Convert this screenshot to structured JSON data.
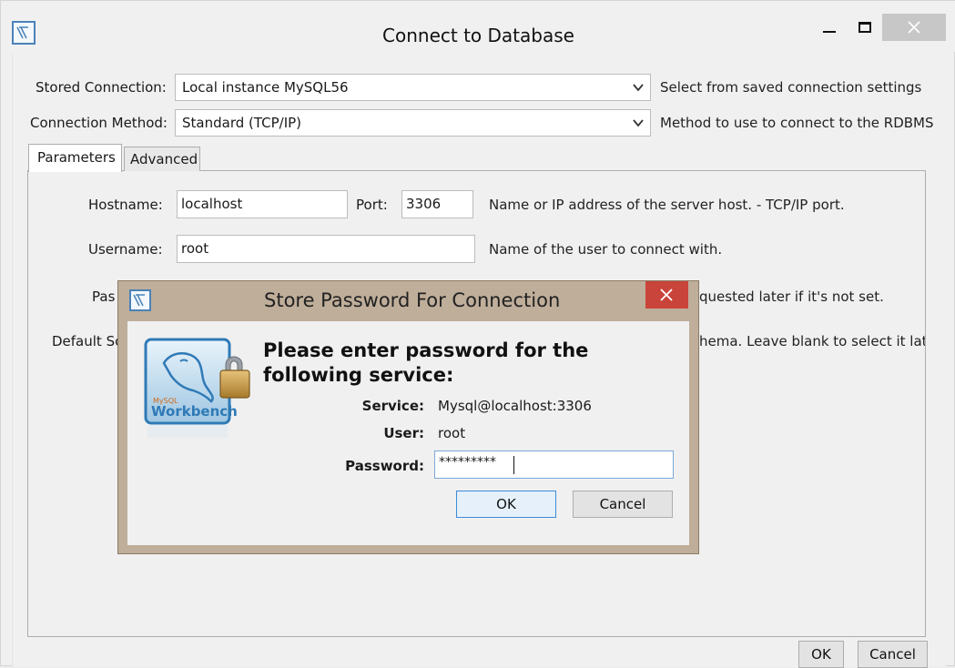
{
  "window": {
    "title": "Connect to Database",
    "buttons": {
      "ok": "OK",
      "cancel": "Cancel"
    }
  },
  "stored_connection": {
    "label": "Stored Connection:",
    "value": "Local instance MySQL56",
    "help": "Select from saved connection settings"
  },
  "connection_method": {
    "label": "Connection Method:",
    "value": "Standard (TCP/IP)",
    "help": "Method to use to connect to the RDBMS"
  },
  "tabs": [
    {
      "label": "Parameters",
      "active": true
    },
    {
      "label": "Advanced",
      "active": false
    }
  ],
  "parameters": {
    "hostname": {
      "label": "Hostname:",
      "value": "localhost"
    },
    "port": {
      "label": "Port:",
      "value": "3306"
    },
    "hostname_help": "Name or IP address of the server host. - TCP/IP port.",
    "username": {
      "label": "Username:",
      "value": "root",
      "help": "Name of the user to connect with."
    },
    "password_label_partial": "Pas",
    "password_help_partial": "quested later if it's not set.",
    "default_schema_label_partial": "Default Sc",
    "default_schema_help_partial": "hema. Leave blank to select it late"
  },
  "dialog": {
    "title": "Store Password For Connection",
    "heading_line1": "Please enter password for the",
    "heading_line2": "following service:",
    "service_label": "Service:",
    "service_value": "Mysql@localhost:3306",
    "user_label": "User:",
    "user_value": "root",
    "password_label": "Password:",
    "password_value": "*********",
    "ok": "OK",
    "cancel": "Cancel",
    "logo_text_small": "MySQL",
    "logo_text": "Workbench"
  },
  "colors": {
    "dialog_frame": "#bfae9a",
    "close_red": "#c9443b",
    "focus_blue": "#7aa7d8"
  }
}
